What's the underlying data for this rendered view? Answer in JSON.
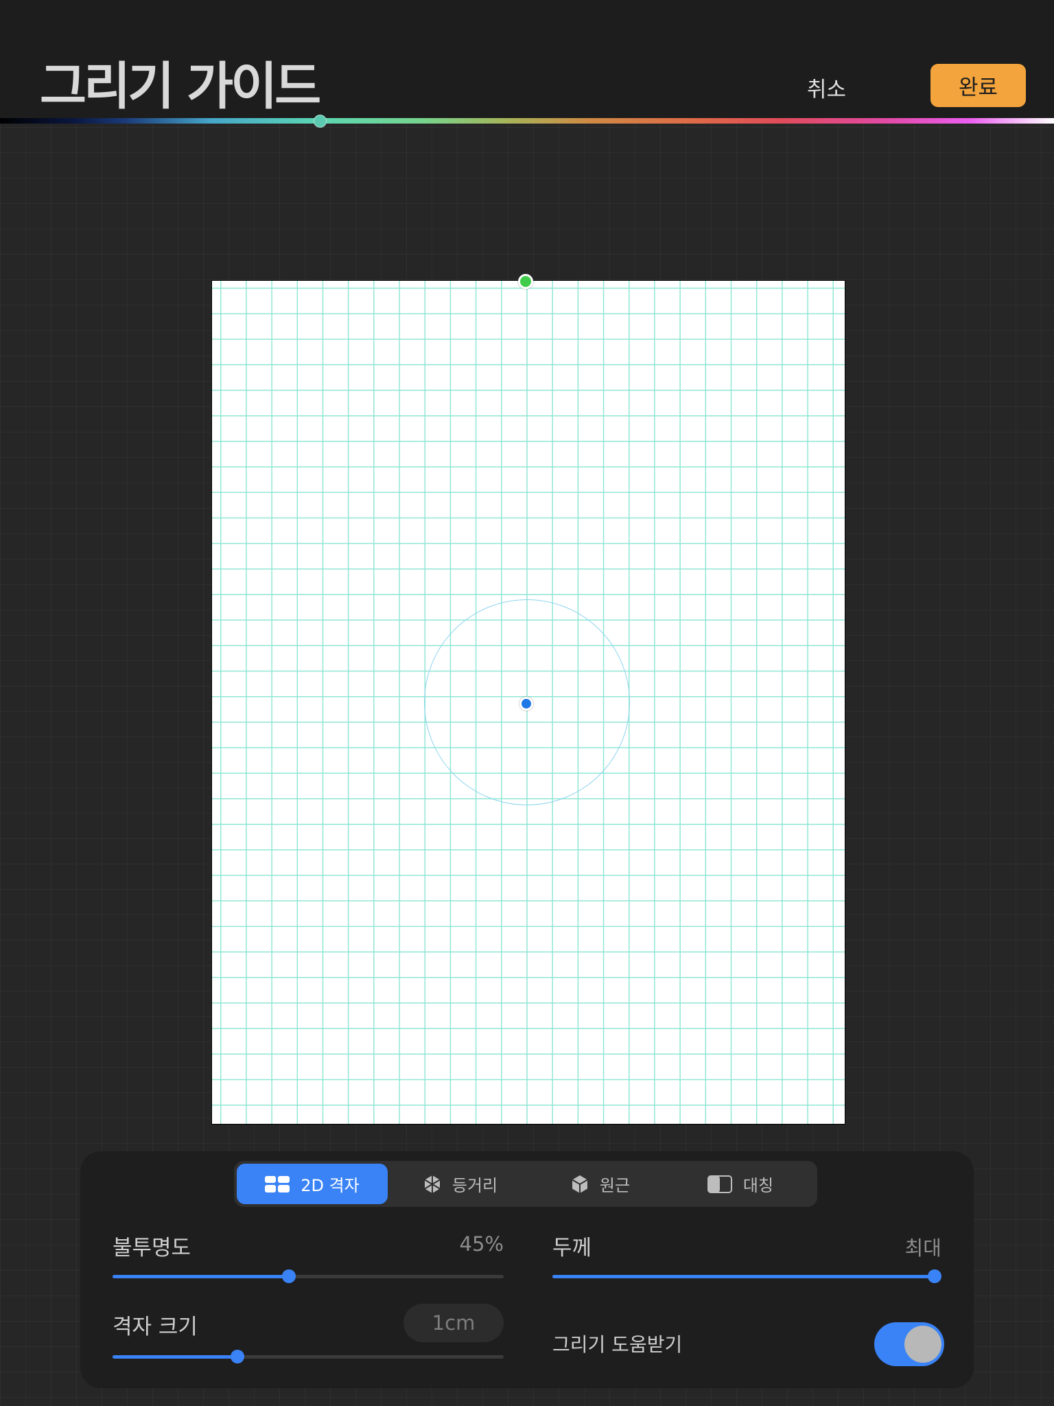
{
  "header": {
    "title": "그리기 가이드",
    "cancel_label": "취소",
    "done_label": "완료",
    "hue_fraction": 0.303
  },
  "colors": {
    "accent": "#3a83f6",
    "done": "#f3a43c",
    "grid": "#8fe6d4",
    "guide_circle": "#8cd4ef",
    "top_handle": "#3fcc4a",
    "center_handle": "#1e78e6"
  },
  "tabs": [
    {
      "label": "2D 격자",
      "icon": "grid-icon",
      "active": true
    },
    {
      "label": "등거리",
      "icon": "isometric-icon",
      "active": false
    },
    {
      "label": "원근",
      "icon": "perspective-icon",
      "active": false
    },
    {
      "label": "대칭",
      "icon": "symmetry-icon",
      "active": false
    }
  ],
  "opacity": {
    "label": "불투명도",
    "value": "45%",
    "fraction": 0.45
  },
  "thickness": {
    "label": "두께",
    "value": "최대",
    "fraction": 1.0
  },
  "grid_size": {
    "label": "격자 크기",
    "value": "1cm",
    "fraction": 0.32
  },
  "assist": {
    "label": "그리기 도움받기",
    "enabled": true
  }
}
